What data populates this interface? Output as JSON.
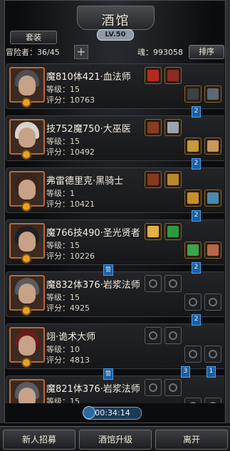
{
  "header": {
    "title": "酒馆",
    "level": "LV.50",
    "tab": "套装"
  },
  "stats": {
    "adventurers": "冒险者：36/45",
    "plus": "+",
    "soul": "魂：993058",
    "sort": "排序"
  },
  "labels": {
    "level": "等级：",
    "score": "评分："
  },
  "heroes": [
    {
      "name": "魔810体421·血法师",
      "level": "15",
      "score": "10763",
      "hair": "#4a4f57",
      "slots": [
        "eq:#b52a1f",
        "eq:#8e2a24",
        "eq:#3b4049",
        "eq:#5a6a78"
      ]
    },
    {
      "name": "技752魔750·大巫医",
      "level": "15",
      "score": "10492",
      "hair": "#d8d4cc",
      "slots": [
        "eq:#8a3c1a",
        "eq:#9da4ad",
        "eq:#c49a3a",
        "eq:#c69a5a"
      ]
    },
    {
      "name": "弗雷德里克·黑骑士",
      "level": "1",
      "score": "10421",
      "hair": "#3a2418",
      "slots": [
        "eq:#8a3a1c",
        "eq:#b58a2c",
        "eq:#c8902c",
        "eq:#4a8ab0"
      ]
    },
    {
      "name": "魔766技490·圣光贤者",
      "level": "15",
      "score": "10226",
      "hair": "#1f2026",
      "slots": [
        "eq:#e2b04a",
        "eq:#2e9a3c",
        "eq:#3aa54a",
        "eq:#b8674a"
      ]
    },
    {
      "name": "魔832体376·岩浆法师",
      "level": "15",
      "score": "4925",
      "hair": "#585c63",
      "slots": [
        "em",
        "em",
        "em",
        "em"
      ]
    },
    {
      "name": "翊·诡术大师",
      "level": "10",
      "score": "4813",
      "hair": "#6a1c1c",
      "slots": [
        "em",
        "em",
        "em",
        "em"
      ]
    },
    {
      "name": "魔821体376·岩浆法师",
      "level": "15",
      "score": "",
      "hair": "#585c63",
      "slots": [
        "em",
        "em",
        "em",
        "em"
      ]
    }
  ],
  "links": [
    "2",
    "2",
    "2",
    "2",
    "赞",
    "2",
    "3",
    "1",
    "赞",
    "3"
  ],
  "timer": "00:34:14",
  "bottom": {
    "recruit": "新人招募",
    "upgrade": "酒馆升级",
    "leave": "离开"
  }
}
